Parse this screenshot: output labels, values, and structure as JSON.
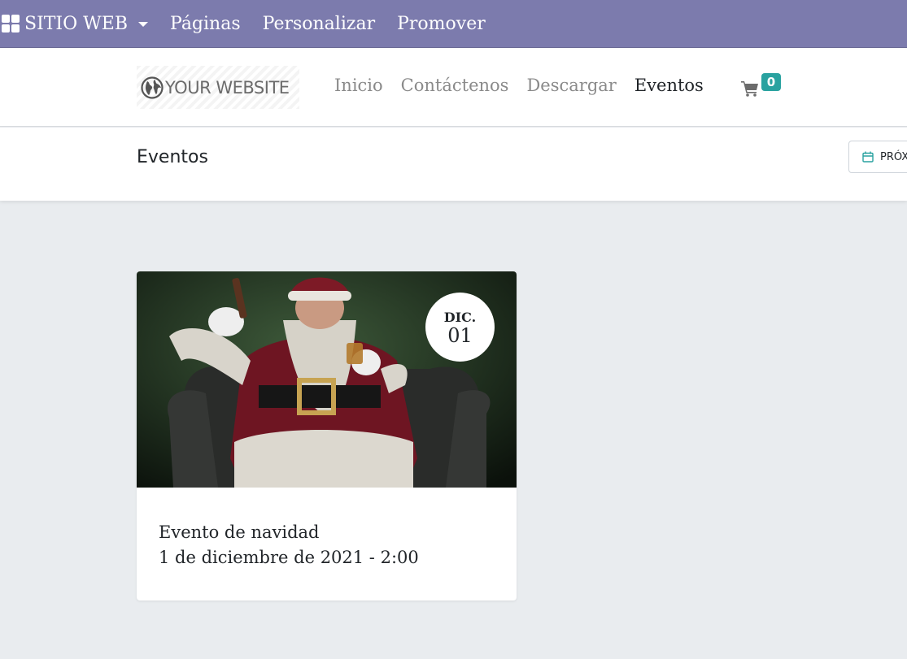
{
  "admin_bar": {
    "apps_label": "SITIO WEB",
    "links": [
      "Páginas",
      "Personalizar",
      "Promover"
    ]
  },
  "header": {
    "logo_text": "YOUR WEBSITE",
    "nav": [
      {
        "label": "Inicio",
        "active": false
      },
      {
        "label": "Contáctenos",
        "active": false
      },
      {
        "label": "Descargar",
        "active": false
      },
      {
        "label": "Eventos",
        "active": true
      }
    ],
    "cart_count": "0"
  },
  "subheader": {
    "title": "Eventos",
    "filter_label": "PRÓX"
  },
  "events": [
    {
      "month": "DIC.",
      "day": "01",
      "name": "Evento de navidad",
      "datetime": "1 de diciembre de 2021 - 2:00"
    }
  ],
  "colors": {
    "admin_bar": "#7c7bad",
    "badge": "#29a2a0",
    "page_bg": "#e9ecef"
  },
  "icons": {
    "apps": "grid-icon",
    "logo": "globe-icon",
    "cart": "cart-icon",
    "filter": "calendar-icon"
  }
}
